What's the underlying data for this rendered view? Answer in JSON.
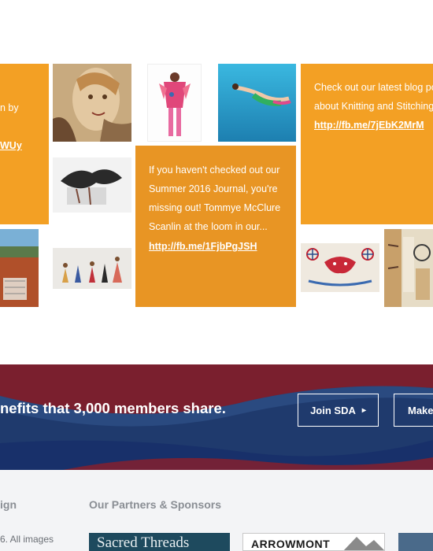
{
  "posts": {
    "left_partial": {
      "line1": "n by",
      "link": "WUy"
    },
    "journal": {
      "lines": [
        "If you haven't checked out our",
        "Summer 2016 Journal, you're",
        "missing out! Tommye McClure",
        "Scanlin at the loom in our..."
      ],
      "link": "http://fb.me/1FjbPgJSH"
    },
    "blog": {
      "lines": [
        "Check out our latest blog po",
        "about Knitting and Stitching"
      ],
      "link": "http://fb.me/7jEbK2MrM"
    }
  },
  "gallery": {
    "images": [
      "portrait-painting-image",
      "costume-figure-image",
      "swimmer-image",
      "sculpture-image",
      "landscape-image",
      "figurines-image",
      "embroidered-textile-image",
      "abstract-art-image"
    ]
  },
  "banner": {
    "text": "nefits that 3,000 members share.",
    "join_label": "Join SDA",
    "join_arrow": "▸",
    "make_label": "Make",
    "colors": {
      "blue": "#1f3a6d",
      "red": "#8b1f2b"
    }
  },
  "footer": {
    "left_heading": "ign",
    "partners_heading": "Our Partners & Sponsors",
    "left_text": "6. All images",
    "sponsor1": "Sacred Threads",
    "sponsor2": "ARROWMONT"
  },
  "colors": {
    "orange": "#f3a024",
    "orange_dark": "#e89524"
  }
}
